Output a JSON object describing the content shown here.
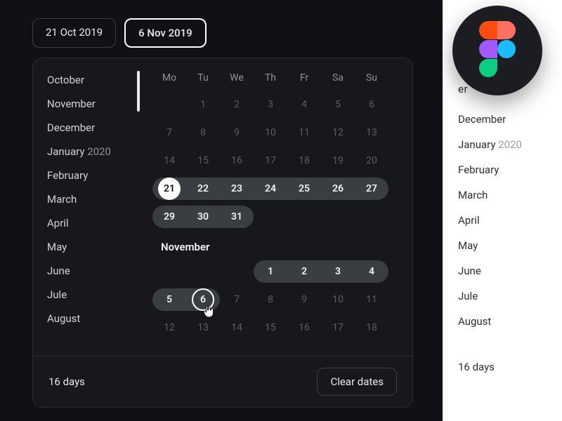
{
  "chips": {
    "start": "21 Oct 2019",
    "end": "6 Nov 2019"
  },
  "months": [
    {
      "label": "October",
      "yr": ""
    },
    {
      "label": "November",
      "yr": ""
    },
    {
      "label": "December",
      "yr": ""
    },
    {
      "label": "January",
      "yr": "2020"
    },
    {
      "label": "February",
      "yr": ""
    },
    {
      "label": "March",
      "yr": ""
    },
    {
      "label": "April",
      "yr": ""
    },
    {
      "label": "May",
      "yr": ""
    },
    {
      "label": "June",
      "yr": ""
    },
    {
      "label": "Jule",
      "yr": ""
    },
    {
      "label": "August",
      "yr": ""
    }
  ],
  "dow": [
    "Mo",
    "Tu",
    "We",
    "Th",
    "Fr",
    "Sa",
    "Su"
  ],
  "oct": {
    "rows": [
      [
        "",
        "1",
        "2",
        "3",
        "4",
        "5",
        "6"
      ],
      [
        "7",
        "8",
        "9",
        "10",
        "11",
        "12",
        "13"
      ],
      [
        "14",
        "15",
        "16",
        "17",
        "18",
        "19",
        "20"
      ],
      [
        "21",
        "22",
        "23",
        "24",
        "25",
        "26",
        "27"
      ],
      [
        "29",
        "30",
        "31"
      ]
    ]
  },
  "nov_label": "November",
  "nov": {
    "rows": [
      [
        "",
        "",
        "",
        "1",
        "2",
        "3",
        "4"
      ],
      [
        "5",
        "6",
        "7",
        "8",
        "9",
        "10",
        "11"
      ],
      [
        "12",
        "13",
        "14",
        "15",
        "16",
        "17",
        "18"
      ]
    ]
  },
  "footer": {
    "count": "16 days",
    "clear": "Clear dates"
  },
  "light_peek": "er",
  "light_months": [
    {
      "label": "December",
      "yr": ""
    },
    {
      "label": "January",
      "yr": "2020"
    },
    {
      "label": "February",
      "yr": ""
    },
    {
      "label": "March",
      "yr": ""
    },
    {
      "label": "April",
      "yr": ""
    },
    {
      "label": "May",
      "yr": ""
    },
    {
      "label": "June",
      "yr": ""
    },
    {
      "label": "Jule",
      "yr": ""
    },
    {
      "label": "August",
      "yr": ""
    }
  ],
  "light_footer": "16 days"
}
